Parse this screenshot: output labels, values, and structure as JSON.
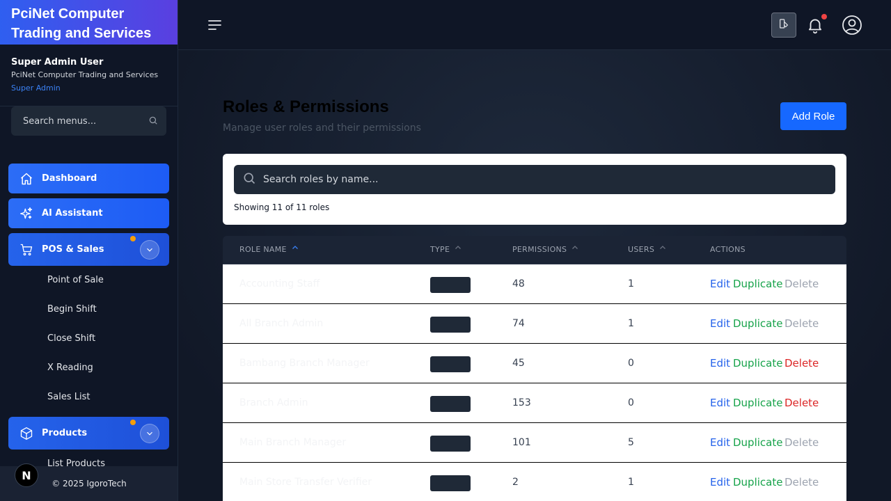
{
  "sidebar": {
    "brand": [
      "PciNet Computer",
      "Trading and Services"
    ],
    "user": {
      "name": "Super Admin User",
      "company": "PciNet Computer Trading and Services",
      "role": "Super Admin"
    },
    "search_placeholder": "Search menus...",
    "items": [
      {
        "label": "Dashboard",
        "icon": "home-icon"
      },
      {
        "label": "AI Assistant",
        "icon": "sparkles-icon"
      },
      {
        "label": "POS & Sales",
        "icon": "cart-icon",
        "submenu": [
          "Point of Sale",
          "Begin Shift",
          "Close Shift",
          "X Reading",
          "Sales List"
        ]
      },
      {
        "label": "Products",
        "icon": "box-icon",
        "submenu": [
          "List Products"
        ]
      }
    ],
    "footer": "© 2025 IgoroTech",
    "fab_letter": "N"
  },
  "header": {
    "icons": [
      "menu-icon",
      "theme-toggle-icon",
      "bell-icon",
      "user-circle-icon"
    ]
  },
  "page": {
    "title": "Roles & Permissions",
    "subtitle": "Manage user roles and their permissions",
    "add_button": "Add Role",
    "search_placeholder": "Search roles by name...",
    "showing": "Showing 11 of 11 roles"
  },
  "table": {
    "columns": [
      "ROLE NAME",
      "TYPE",
      "PERMISSIONS",
      "USERS",
      "ACTIONS"
    ],
    "action_labels": {
      "edit": "Edit",
      "duplicate": "Duplicate",
      "delete": "Delete"
    },
    "rows": [
      {
        "name": "Accounting Staff",
        "permissions": "48",
        "users": "1",
        "delete_enabled": false
      },
      {
        "name": "All Branch Admin",
        "permissions": "74",
        "users": "1",
        "delete_enabled": false
      },
      {
        "name": "Bambang Branch Manager",
        "permissions": "45",
        "users": "0",
        "delete_enabled": true
      },
      {
        "name": "Branch Admin",
        "permissions": "153",
        "users": "0",
        "delete_enabled": true
      },
      {
        "name": "Main Branch Manager",
        "permissions": "101",
        "users": "5",
        "delete_enabled": false
      },
      {
        "name": "Main Store Transfer Verifier",
        "permissions": "2",
        "users": "1",
        "delete_enabled": false
      }
    ]
  },
  "colors": {
    "primary": "#1668ff",
    "edit": "#2563eb",
    "duplicate": "#16a34a",
    "delete": "#dc2626",
    "notification": "#ef4444",
    "badge_dot": "#f59e0b"
  }
}
